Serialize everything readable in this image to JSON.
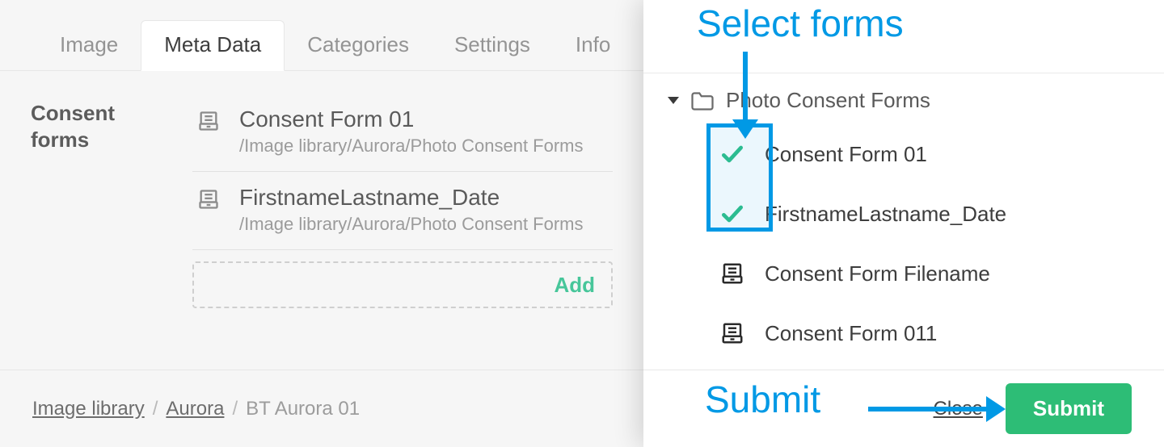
{
  "tabs": {
    "image": "Image",
    "meta": "Meta Data",
    "categories": "Categories",
    "settings": "Settings",
    "info": "Info"
  },
  "meta": {
    "field_label": "Consent forms",
    "forms": [
      {
        "title": "Consent Form 01",
        "path": "/Image library/Aurora/Photo Consent Forms"
      },
      {
        "title": "FirstnameLastname_Date",
        "path": "/Image library/Aurora/Photo Consent Forms"
      }
    ],
    "add_label": "Add"
  },
  "breadcrumb": {
    "root": "Image library",
    "folder": "Aurora",
    "current": "BT Aurora 01",
    "sep": "/"
  },
  "picker": {
    "folder_label": "Photo Consent Forms",
    "items": [
      {
        "label": "Consent Form 01",
        "selected": true
      },
      {
        "label": "FirstnameLastname_Date",
        "selected": true
      },
      {
        "label": "Consent Form Filename",
        "selected": false
      },
      {
        "label": "Consent Form 011",
        "selected": false
      }
    ],
    "close_label": "Close",
    "submit_label": "Submit"
  },
  "annotations": {
    "select_forms": "Select forms",
    "submit": "Submit"
  }
}
